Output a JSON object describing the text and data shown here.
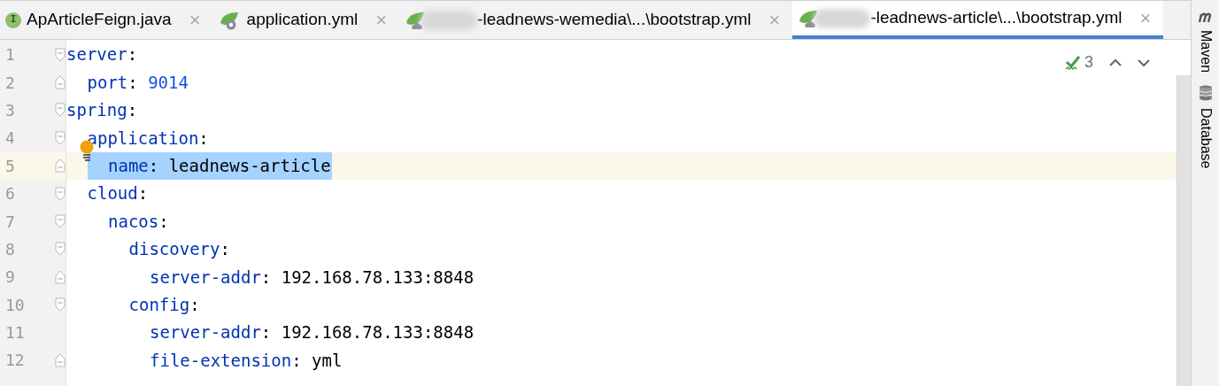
{
  "tabs": [
    {
      "kind": "interface",
      "badge": "I",
      "label": "ApArticleFeign.java",
      "close": "×",
      "redacted": false,
      "selected": false
    },
    {
      "kind": "spring-gear",
      "label": "application.yml",
      "close": "×",
      "redacted": false,
      "selected": false
    },
    {
      "kind": "spring-cloud",
      "label": "-leadnews-wemedia\\...\\bootstrap.yml",
      "close": "×",
      "redacted": true,
      "selected": false
    },
    {
      "kind": "spring-cloud",
      "label": "-leadnews-article\\...\\bootstrap.yml",
      "close": "×",
      "redacted": true,
      "selected": true
    }
  ],
  "inspection": {
    "count": "3"
  },
  "side_tools": [
    {
      "kind": "maven",
      "label": "Maven"
    },
    {
      "kind": "database",
      "label": "Database"
    }
  ],
  "lines": [
    {
      "number": "1",
      "key": "server",
      "separator": ":",
      "block_start": true,
      "block_end": false,
      "current": false,
      "children": [
        {
          "number": "2",
          "key": "port",
          "separator": ":",
          "value": "9014",
          "kind": "number",
          "block_start": false,
          "block_end": true,
          "current": false
        }
      ]
    },
    {
      "number": "3",
      "key": "spring",
      "separator": ":",
      "block_start": true,
      "block_end": false,
      "current": false,
      "children": [
        {
          "number": "4",
          "key": "application",
          "separator": ":",
          "block_start": true,
          "block_end": false,
          "current": false,
          "children": [
            {
              "number": "5",
              "key": "name",
              "separator": ":",
              "value": "leadnews-article",
              "kind": "string",
              "block_start": false,
              "block_end": true,
              "current": true
            }
          ]
        },
        {
          "number": "6",
          "key": "cloud",
          "separator": ":",
          "block_start": true,
          "block_end": false,
          "current": false,
          "children": [
            {
              "number": "7",
              "key": "nacos",
              "separator": ":",
              "block_start": true,
              "block_end": false,
              "current": false,
              "children": [
                {
                  "number": "8",
                  "key": "discovery",
                  "separator": ":",
                  "block_start": true,
                  "block_end": false,
                  "current": false,
                  "children": [
                    {
                      "number": "9",
                      "key": "server-addr",
                      "separator": ":",
                      "value": "192.168.78.133:8848",
                      "kind": "string",
                      "block_start": false,
                      "block_end": true,
                      "current": false
                    }
                  ]
                },
                {
                  "number": "10",
                  "key": "config",
                  "separator": ":",
                  "block_start": true,
                  "block_end": false,
                  "current": false,
                  "children": [
                    {
                      "number": "11",
                      "key": "server-addr",
                      "separator": ":",
                      "value": "192.168.78.133:8848",
                      "kind": "string",
                      "block_start": false,
                      "block_end": false,
                      "current": false
                    },
                    {
                      "number": "12",
                      "key": "file-extension",
                      "separator": ":",
                      "value": "yml",
                      "kind": "string",
                      "block_start": false,
                      "block_end": true,
                      "current": false
                    }
                  ]
                }
              ]
            }
          ]
        }
      ]
    }
  ]
}
